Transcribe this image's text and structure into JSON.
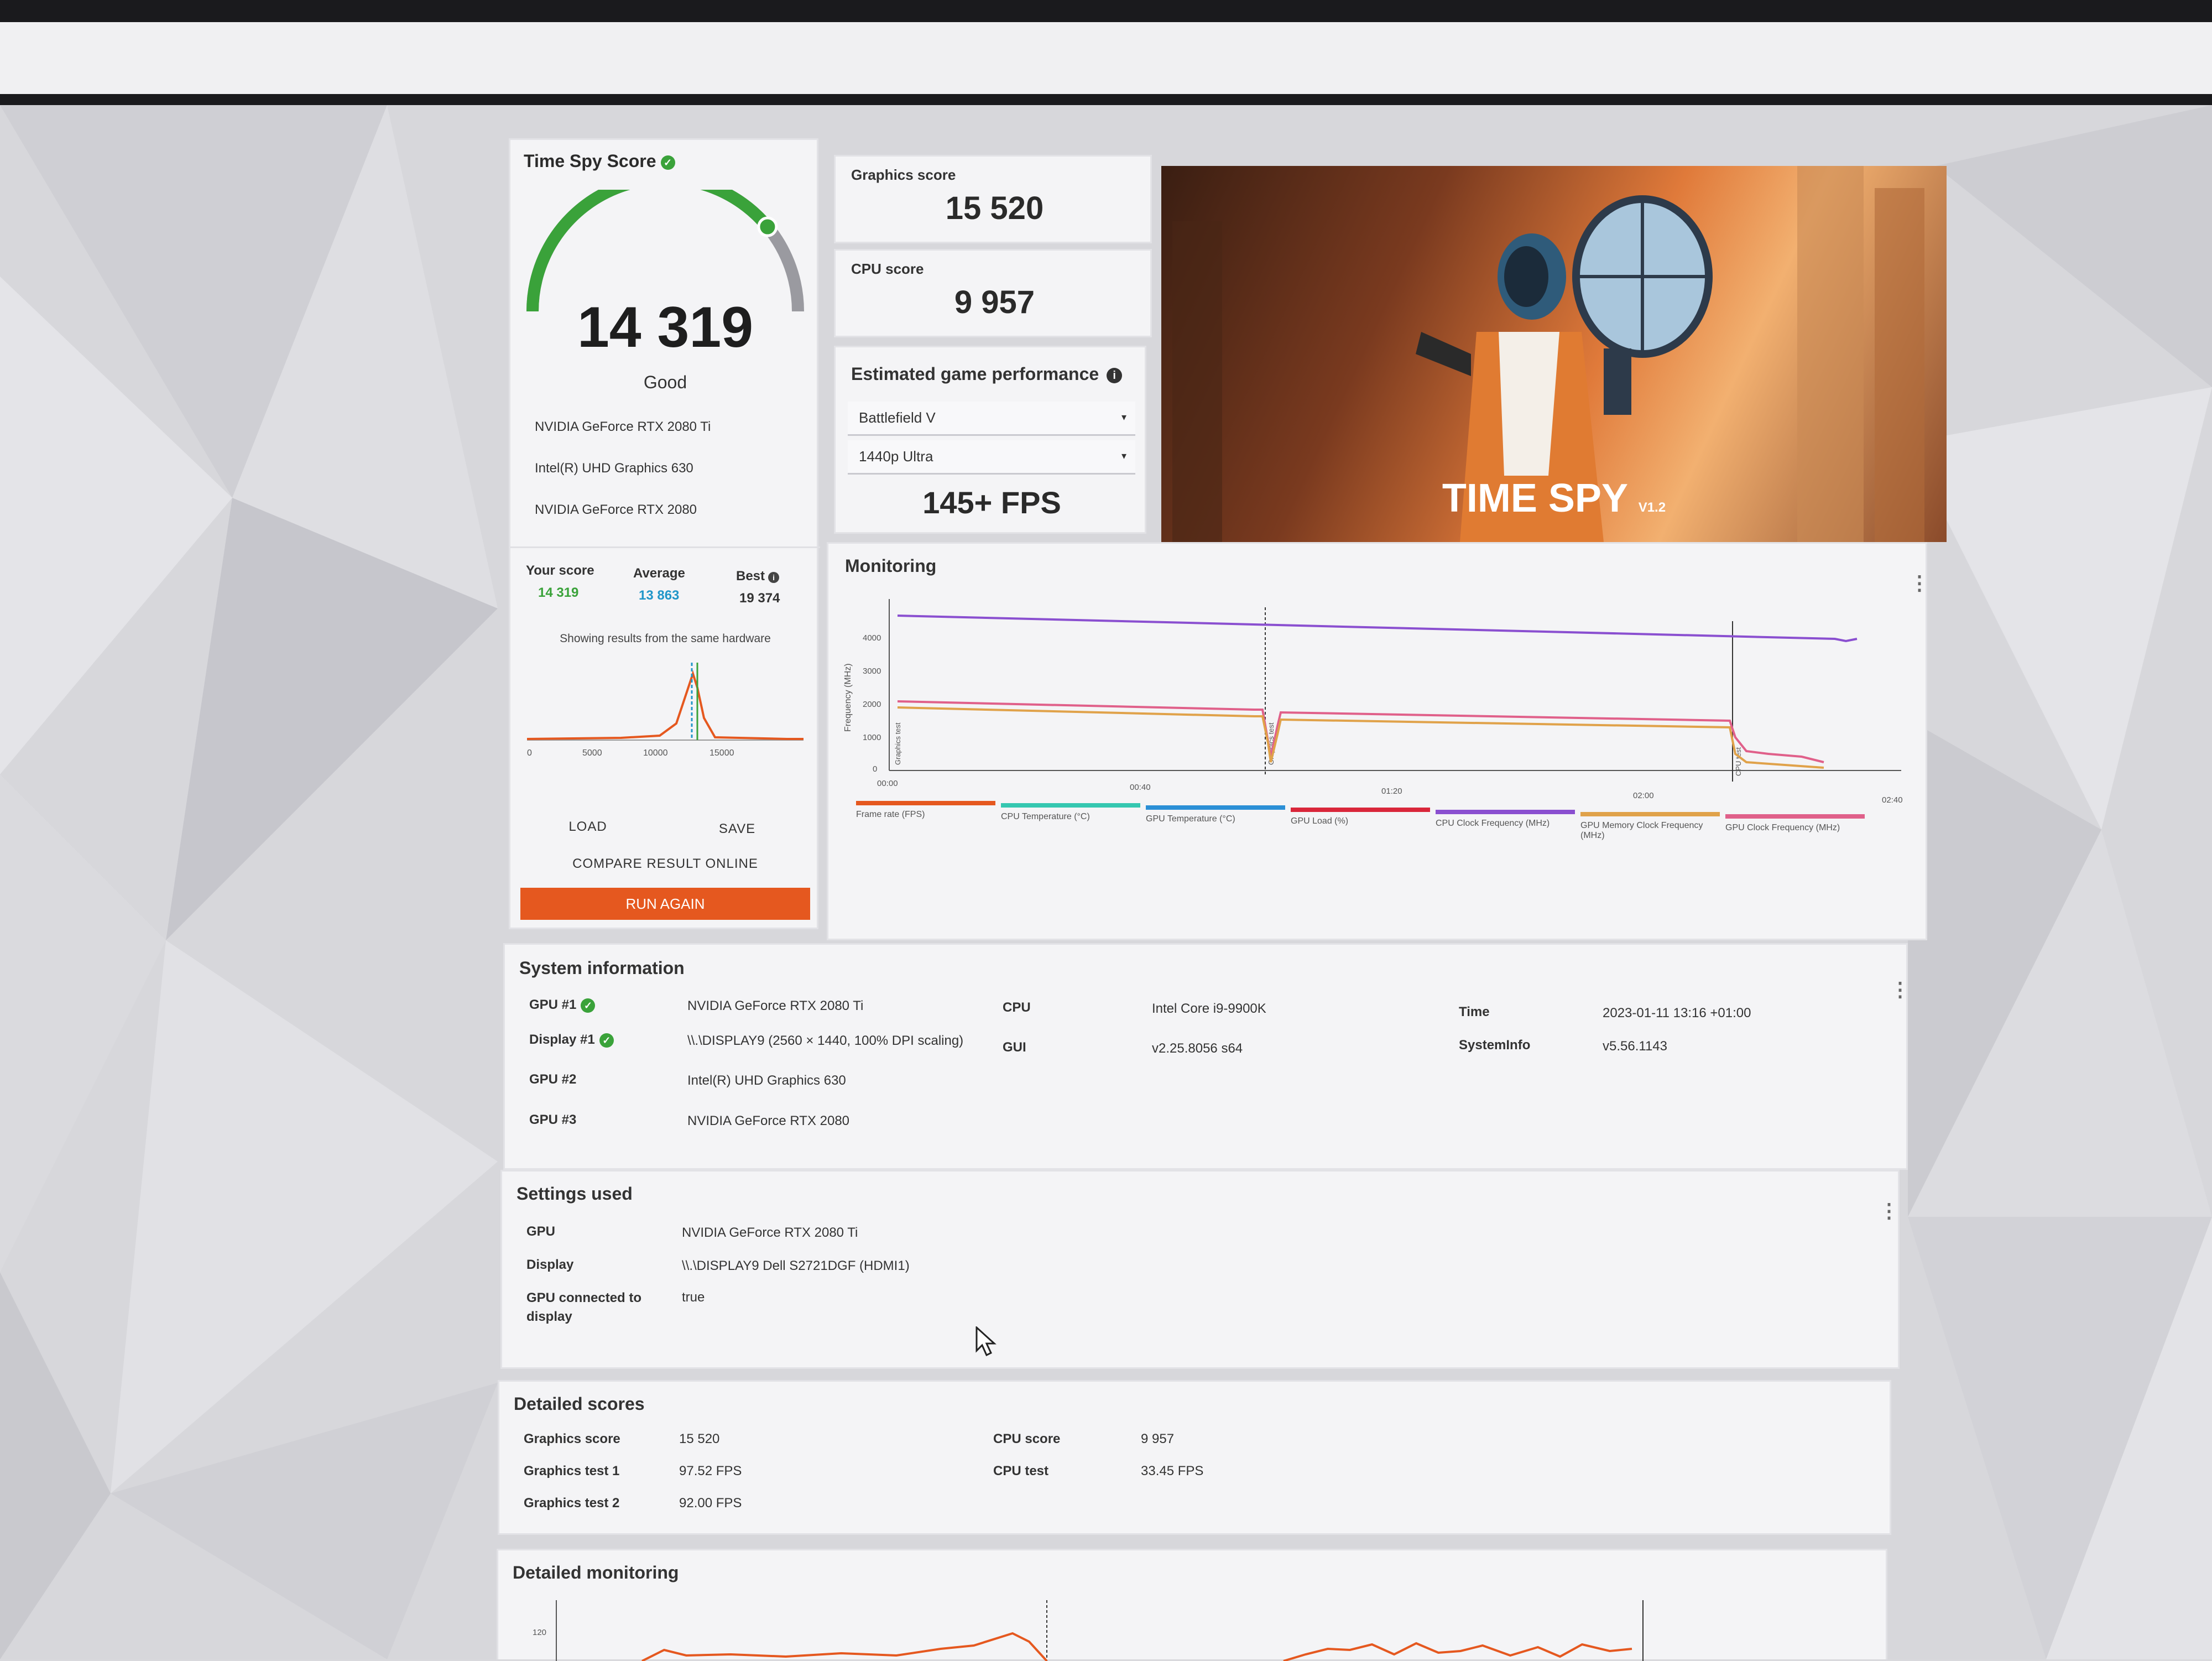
{
  "colors": {
    "accent_orange": "#e5581f",
    "good_green": "#3aa23a",
    "average_blue": "#2196c9"
  },
  "score_card": {
    "title": "Time Spy Score",
    "score": "14 319",
    "rating": "Good",
    "gauge_fraction": 0.78,
    "gpus": [
      "NVIDIA GeForce RTX 2080 Ti",
      "Intel(R) UHD Graphics 630",
      "NVIDIA GeForce RTX 2080"
    ],
    "your_score_label": "Your score",
    "your_score": "14 319",
    "average_label": "Average",
    "average": "13 863",
    "best_label": "Best",
    "best": "19 374",
    "showing_note": "Showing results from the same hardware",
    "dist_ticks": [
      "0",
      "5000",
      "10000",
      "15000"
    ],
    "load_label": "LOAD",
    "save_label": "SAVE",
    "compare_label": "COMPARE RESULT ONLINE",
    "run_again_label": "RUN AGAIN"
  },
  "graphics_score": {
    "label": "Graphics score",
    "value": "15 520"
  },
  "cpu_score": {
    "label": "CPU score",
    "value": "9 957"
  },
  "estimated": {
    "title": "Estimated game performance",
    "game": "Battlefield V",
    "resolution": "1440p Ultra",
    "fps": "145+ FPS"
  },
  "banner": {
    "title": "TIME SPY",
    "version": "V1.2"
  },
  "monitoring": {
    "title": "Monitoring",
    "y_label": "Frequency (MHz)",
    "y_ticks": [
      "4000",
      "3000",
      "2000",
      "1000",
      "0"
    ],
    "x_ticks": [
      "00:00",
      "00:40",
      "01:20",
      "02:00",
      "02:40"
    ],
    "markers": [
      "Graphics test",
      "Graphics test",
      "CPU test"
    ],
    "legend": [
      {
        "label": "Frame rate (FPS)",
        "color": "#e5581f"
      },
      {
        "label": "CPU Temperature (°C)",
        "color": "#35c7b0"
      },
      {
        "label": "GPU Temperature (°C)",
        "color": "#2b8fd6"
      },
      {
        "label": "GPU Load (%)",
        "color": "#d9263a"
      },
      {
        "label": "CPU Clock Frequency (MHz)",
        "color": "#8a4fd0"
      },
      {
        "label": "GPU Memory Clock Frequency (MHz)",
        "color": "#e0a24a"
      },
      {
        "label": "GPU Clock Frequency (MHz)",
        "color": "#e0608a"
      }
    ]
  },
  "system_info": {
    "title": "System information",
    "rows_left": [
      {
        "key": "GPU #1",
        "value": "NVIDIA GeForce RTX 2080 Ti",
        "check": true
      },
      {
        "key": "Display #1",
        "value": "\\\\.\\DISPLAY9 (2560 × 1440, 100% DPI scaling)",
        "check": true
      },
      {
        "key": "GPU #2",
        "value": "Intel(R) UHD Graphics 630",
        "check": false
      },
      {
        "key": "GPU #3",
        "value": "NVIDIA GeForce RTX 2080",
        "check": false
      }
    ],
    "rows_mid": [
      {
        "key": "CPU",
        "value": "Intel Core i9-9900K"
      },
      {
        "key": "GUI",
        "value": "v2.25.8056 s64"
      }
    ],
    "rows_right": [
      {
        "key": "Time",
        "value": "2023-01-11 13:16 +01:00"
      },
      {
        "key": "SystemInfo",
        "value": "v5.56.1143"
      }
    ]
  },
  "settings": {
    "title": "Settings used",
    "rows": [
      {
        "key": "GPU",
        "value": "NVIDIA GeForce RTX 2080 Ti"
      },
      {
        "key": "Display",
        "value": "\\\\.\\DISPLAY9 Dell S2721DGF (HDMI1)"
      },
      {
        "key": "GPU connected to display",
        "value": "true"
      }
    ]
  },
  "detailed_scores": {
    "title": "Detailed scores",
    "left": [
      {
        "key": "Graphics score",
        "value": "15 520"
      },
      {
        "key": "Graphics test 1",
        "value": "97.52 FPS"
      },
      {
        "key": "Graphics test 2",
        "value": "92.00 FPS"
      }
    ],
    "right": [
      {
        "key": "CPU score",
        "value": "9 957"
      },
      {
        "key": "CPU test",
        "value": "33.45 FPS"
      }
    ]
  },
  "detailed_monitoring": {
    "title": "Detailed monitoring",
    "y_tick": "120"
  }
}
